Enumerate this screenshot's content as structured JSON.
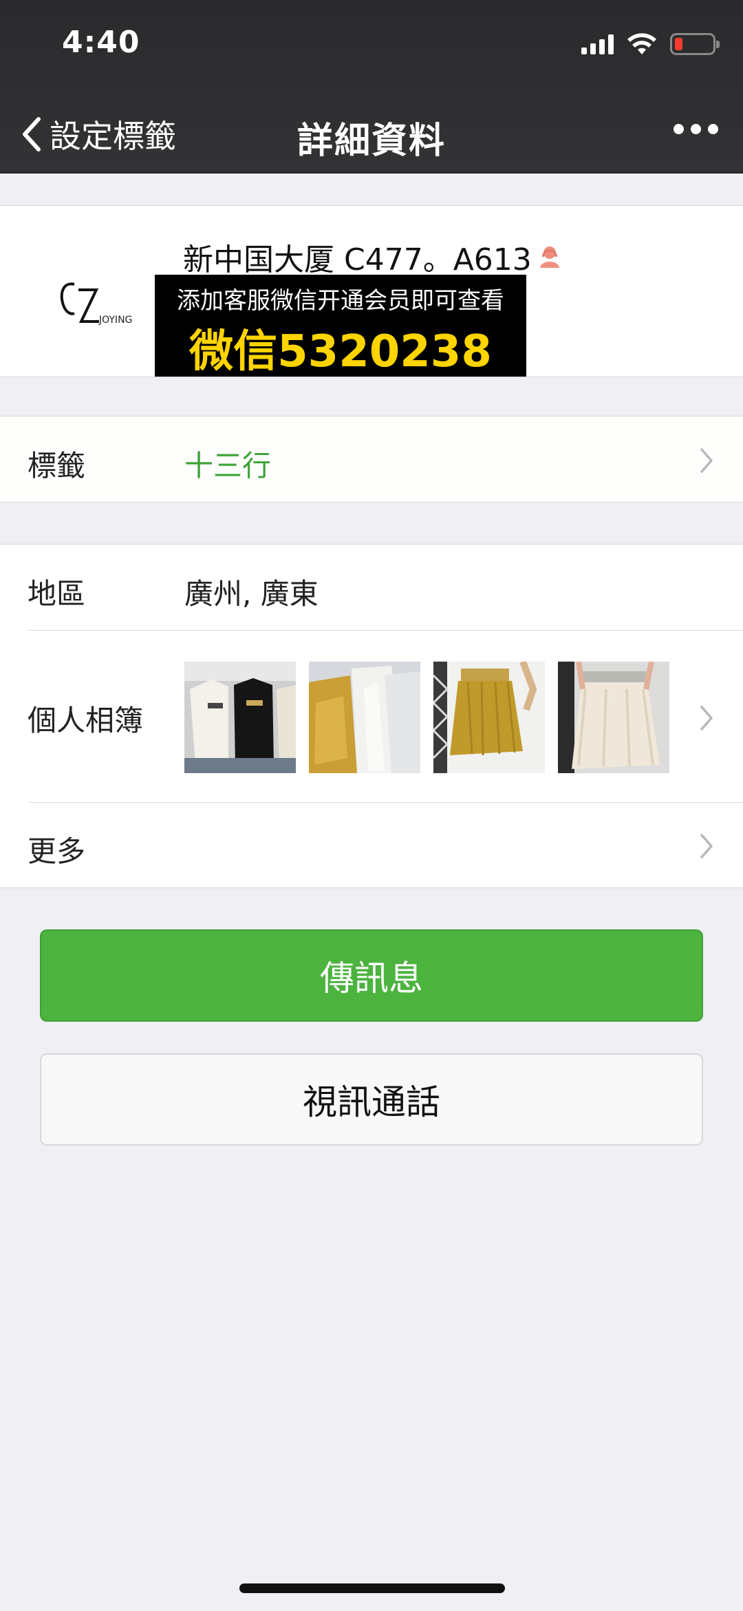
{
  "status_bar": {
    "time": "4:40"
  },
  "navbar": {
    "back_label": "設定標籤",
    "title": "詳細資料"
  },
  "profile": {
    "name": "新中国大厦 C477。A613",
    "avatar_logo_text": "JOYING",
    "promo_line1": "添加客服微信开通会员即可查看",
    "promo_line2": "微信5320238"
  },
  "rows": {
    "tag_label": "標籤",
    "tag_value": "十三行",
    "region_label": "地區",
    "region_value": "廣州, 廣東",
    "album_label": "個人相簿",
    "more_label": "更多"
  },
  "buttons": {
    "message": "傳訊息",
    "video_call": "視訊通話"
  },
  "colors": {
    "accent_green": "#4cb33f",
    "tag_value_green": "#3fa33a",
    "promo_yellow": "#ffd400",
    "nav_background": "#2f2f31"
  },
  "icons": [
    "back-chevron-icon",
    "more-dots-icon",
    "female-user-icon",
    "chevron-right-icon",
    "signal-icon",
    "wifi-icon",
    "battery-icon"
  ]
}
